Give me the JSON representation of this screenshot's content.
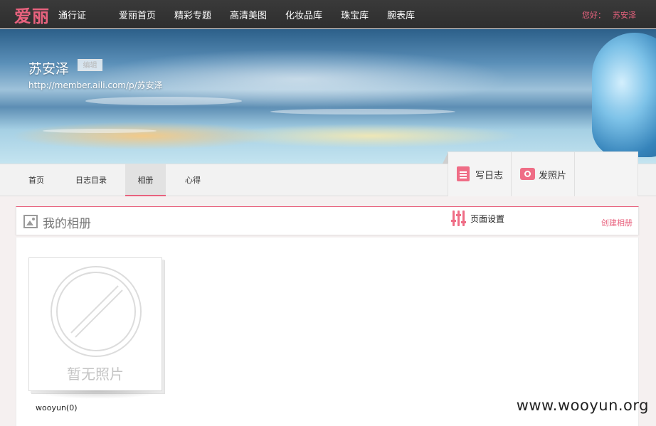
{
  "topnav": {
    "logo": "爱丽",
    "passport": "通行证",
    "links": [
      "爱丽首页",
      "精彩专题",
      "高清美图",
      "化妆品库",
      "珠宝库",
      "腕表库"
    ],
    "greeting": "您好：",
    "user": "苏安泽"
  },
  "profile": {
    "name": "苏安泽",
    "edit_label": "编辑",
    "url": "http://member.aili.com/p/苏安泽"
  },
  "subnav": {
    "tabs": [
      "首页",
      "日志目录",
      "相册",
      "心得"
    ],
    "active_tab": "相册",
    "write_blog": "写日志",
    "post_photo": "发照片"
  },
  "album_section": {
    "title": "我的相册",
    "settings_label": "页面设置",
    "create_label": "创建相册"
  },
  "albums": [
    {
      "placeholder_text": "暂无照片",
      "name": "wooyun(0)"
    }
  ],
  "watermark": "www.wooyun.org",
  "colors": {
    "accent": "#e8627e",
    "nav_bg": "#333333"
  }
}
